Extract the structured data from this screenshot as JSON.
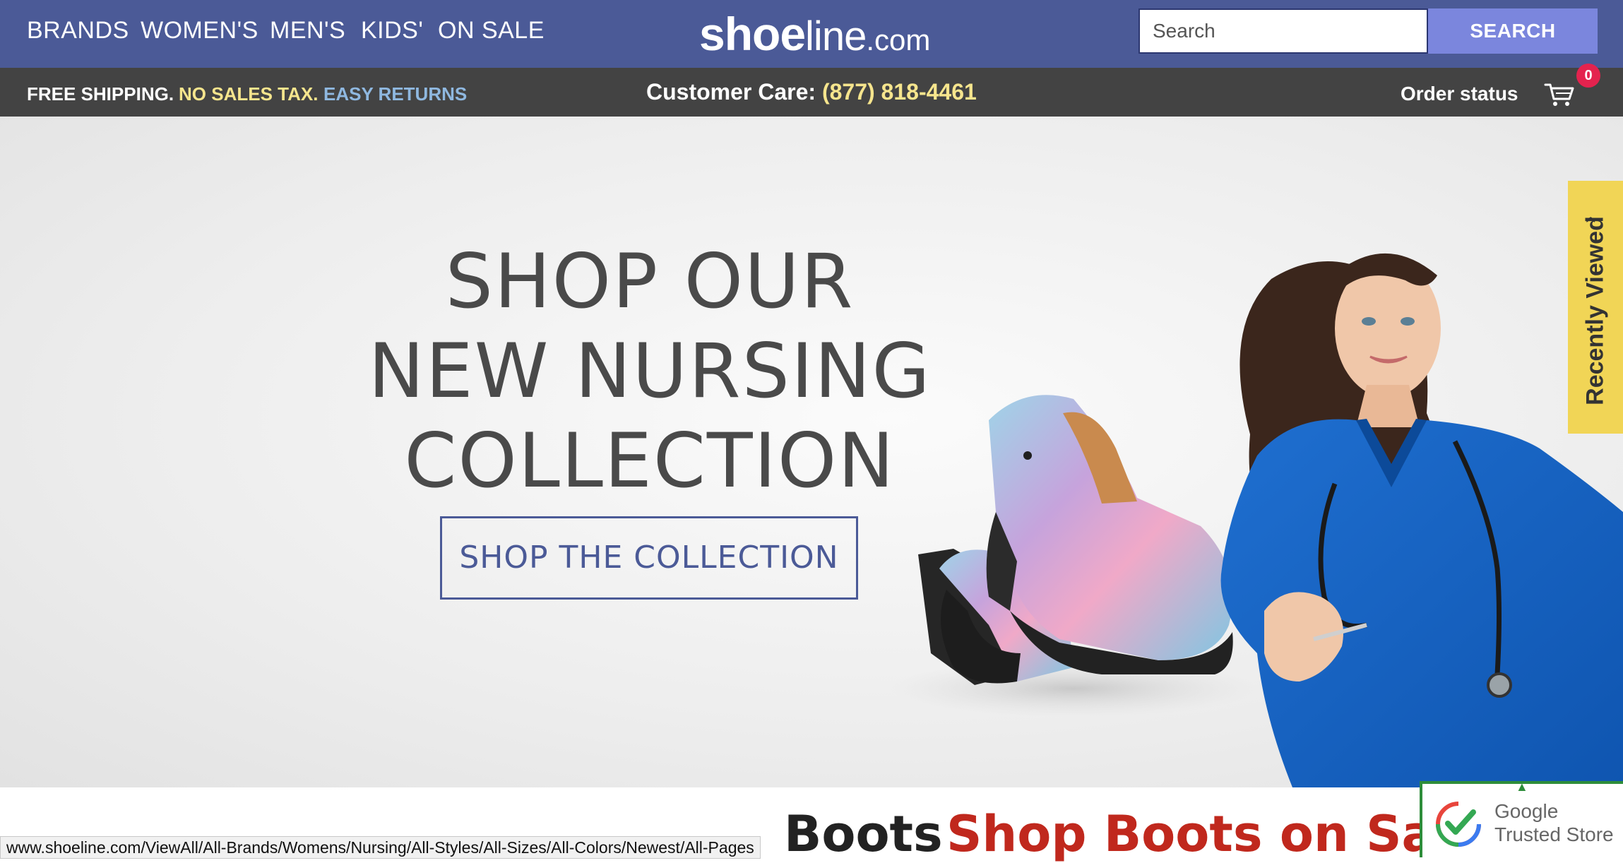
{
  "nav": {
    "brands": "BRANDS",
    "womens": "WOMEN'S",
    "mens": "MEN'S",
    "kids": "KIDS'",
    "on_sale": "ON SALE"
  },
  "logo": {
    "bold": "shoe",
    "light": "line",
    "tld": ".com"
  },
  "search": {
    "placeholder": "Search",
    "button": "SEARCH"
  },
  "infobar": {
    "free_shipping": "FREE SHIPPING.",
    "no_sales_tax": "NO SALES TAX.",
    "easy_returns": "EASY RETURNS",
    "care_label": "Customer Care:",
    "care_phone": "(877) 818-4461",
    "order_status": "Order status",
    "cart_count": "0"
  },
  "hero": {
    "line1": "SHOP OUR",
    "line2": "NEW NURSING",
    "line3": "COLLECTION",
    "cta": "SHOP THE COLLECTION"
  },
  "recently_viewed": {
    "label": "Recently Viewed"
  },
  "below_fold": {
    "heading_visible": "Boots",
    "sale": "Shop Boots on Sale"
  },
  "status_bar": {
    "url": "www.shoeline.com/ViewAll/All-Brands/Womens/Nursing/All-Styles/All-Sizes/All-Colors/Newest/All-Pages"
  },
  "google_badge": {
    "line1": "Google",
    "line2": "Trusted Store"
  },
  "colors": {
    "nav_bg": "#4b5a97",
    "search_button": "#7b86dd",
    "info_bg": "#434343",
    "yellow_text": "#f6e58d",
    "blue_text": "#8fb8e0",
    "recent_tab": "#f1d556",
    "sale_red": "#c0281d",
    "cart_badge": "#e4234e"
  },
  "icons": {
    "cart": "shopping-cart-icon",
    "chevron": "chevron-up-icon",
    "google_check": "checkmark-shield-icon"
  }
}
